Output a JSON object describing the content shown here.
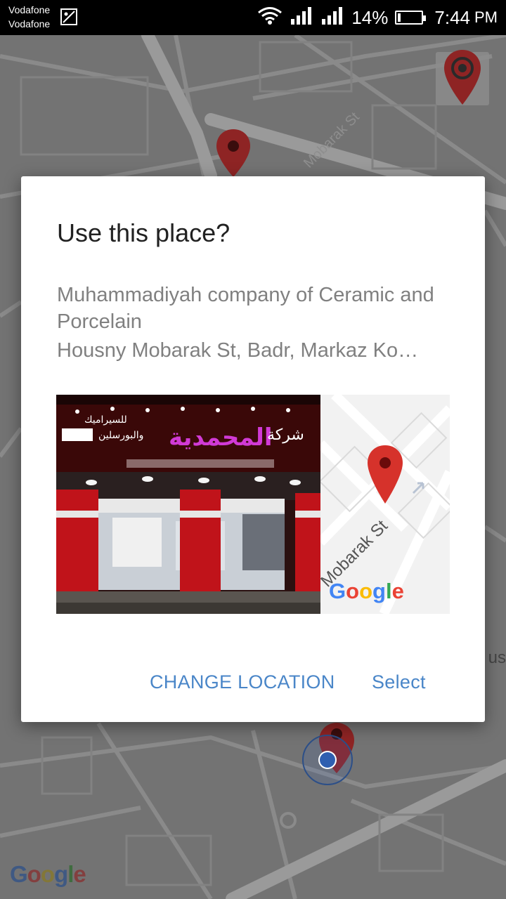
{
  "status_bar": {
    "carrier_1": "Vodafone",
    "carrier_2": "Vodafone",
    "battery": "14%",
    "battery_level": 0.14,
    "time": "7:44",
    "ampm": "PM",
    "icons": [
      "gallery-icon",
      "wifi-icon",
      "signal-icon",
      "signal-icon",
      "battery-icon"
    ]
  },
  "map": {
    "street_label": "Housny Mobarak St",
    "street_label_short": "Mobarak St",
    "edge_text": "us",
    "logo": "Google",
    "pin_color": "#c62828",
    "user_dot_color": "#2f6bd6"
  },
  "dialog": {
    "title": "Use this place?",
    "place_name": "Muhammadiyah company of Ceramic and Porcelain",
    "address": "Housny Mobarak St, Badr, Markaz Ko…",
    "mini_map": {
      "street": "Mobarak St",
      "logo": "Google"
    },
    "buttons": {
      "change": "CHANGE LOCATION",
      "select": "Select"
    },
    "accent": "#4a86c8"
  },
  "photo": {
    "sign_line_1": "شركة",
    "sign_line_2": "للسيراميك",
    "sign_line_3": "والبورسلين",
    "sign_brand": "المحمدية"
  }
}
